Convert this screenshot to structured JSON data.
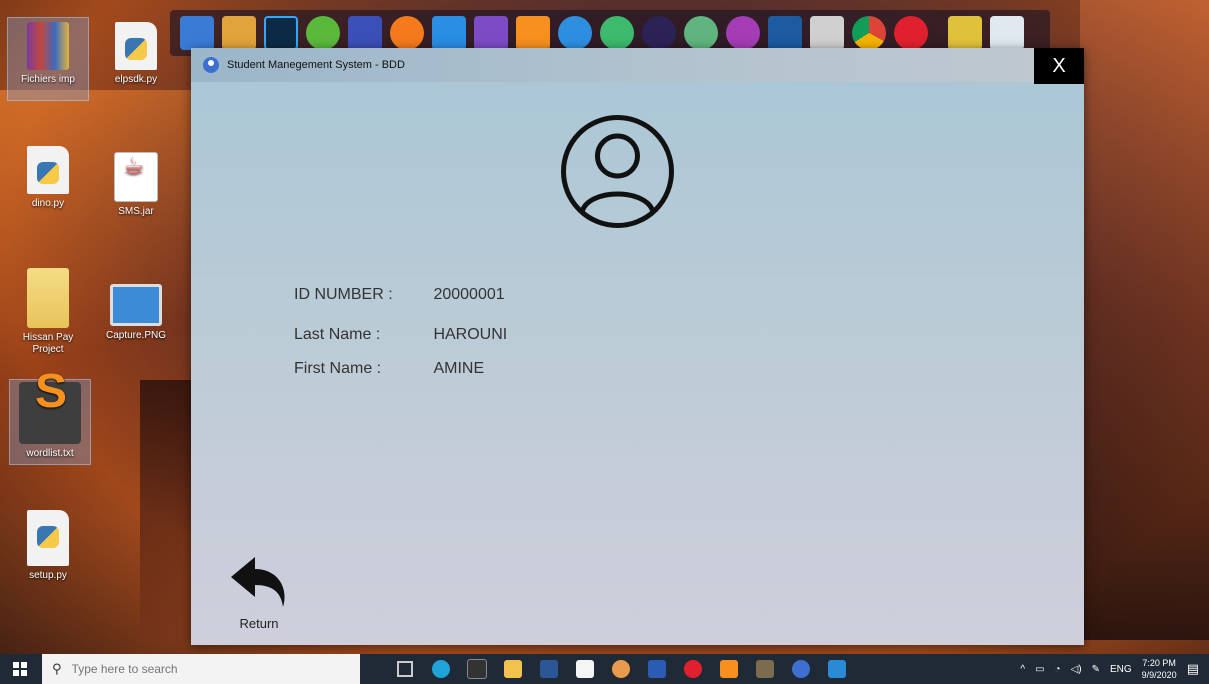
{
  "desktop": {
    "icons": [
      {
        "label": "Fichiers imp",
        "type": "rar"
      },
      {
        "label": "elpsdk.py",
        "type": "py"
      },
      {
        "label": "dino.py",
        "type": "py"
      },
      {
        "label": "SMS.jar",
        "type": "java"
      },
      {
        "label": "Hissan Pay Project",
        "type": "folder"
      },
      {
        "label": "Capture.PNG",
        "type": "png"
      },
      {
        "label": "wordlist.txt",
        "type": "subl"
      },
      {
        "label": "setup.py",
        "type": "py"
      }
    ]
  },
  "window": {
    "title": "Student Manegement System - BDD",
    "close_label": "X",
    "avatar_icon": "user-circle-icon",
    "fields": [
      {
        "label": "ID NUMBER :",
        "value": "20000001"
      },
      {
        "label": "Last Name :",
        "value": "HAROUNI"
      },
      {
        "label": "First Name :",
        "value": "AMINE"
      }
    ],
    "return_label": "Return"
  },
  "taskbar": {
    "search_placeholder": "Type here to search",
    "language": "ENG",
    "time": "7:20 PM",
    "date": "9/9/2020"
  },
  "colors": {
    "taskbar_bg": "#1f2a36",
    "window_top": "#a9c6d6",
    "window_bottom": "#cfcfdc",
    "close_bg": "#000000"
  }
}
